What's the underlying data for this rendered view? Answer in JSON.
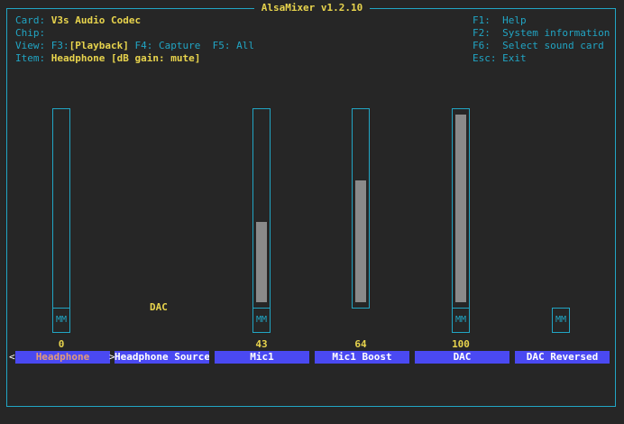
{
  "title": "AlsaMixer v1.2.10",
  "info": {
    "card_label": "Card:",
    "card_value": "V3s Audio Codec",
    "chip_label": "Chip:",
    "chip_value": "",
    "view_label": "View:",
    "view_f3": "F3:",
    "view_playback": "[Playback]",
    "view_f4": "F4: Capture",
    "view_f5": "F5: All",
    "item_label": "Item:",
    "item_value": "Headphone [dB gain: mute]"
  },
  "help": [
    {
      "key": "F1:",
      "text": "Help"
    },
    {
      "key": "F2:",
      "text": "System information"
    },
    {
      "key": "F6:",
      "text": "Select sound card"
    },
    {
      "key": "Esc:",
      "text": "Exit"
    }
  ],
  "controls": [
    {
      "name": "Headphone",
      "value_text": "0",
      "level": 0.0,
      "mute": "MM",
      "selected": true
    },
    {
      "name": "Headphone Source",
      "route_value": "DAC"
    },
    {
      "name": "Mic1",
      "value_text": "43",
      "level": 0.43,
      "mute": "MM"
    },
    {
      "name": "Mic1 Boost",
      "value_text": "64",
      "level": 0.65
    },
    {
      "name": "DAC",
      "value_text": "100",
      "level": 1.0,
      "mute": "MM"
    },
    {
      "name": "DAC Reversed",
      "mute": "MM"
    }
  ],
  "arrows": {
    "left": "<",
    "right": ">"
  }
}
